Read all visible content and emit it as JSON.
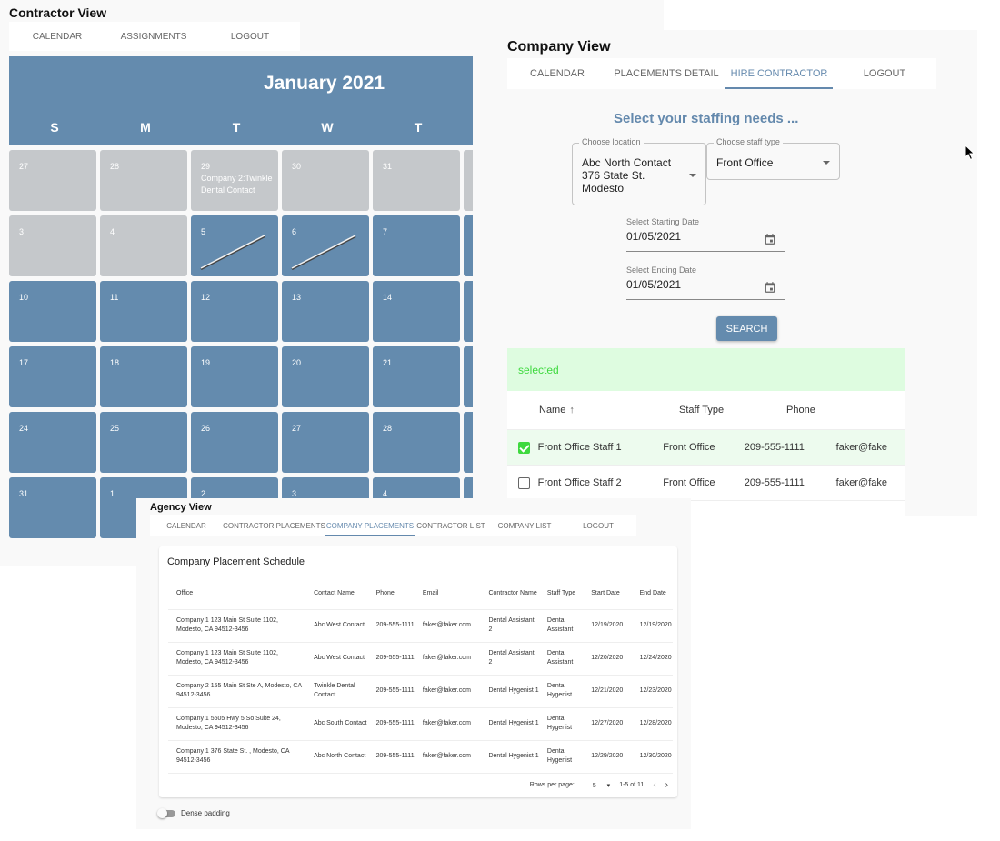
{
  "contractor": {
    "title": "Contractor View",
    "tabs": [
      {
        "label": "CALENDAR",
        "active": false
      },
      {
        "label": "ASSIGNMENTS",
        "active": false
      },
      {
        "label": "LOGOUT",
        "active": false
      }
    ],
    "calendar": {
      "month_label": "January 2021",
      "weekdays": [
        "S",
        "M",
        "T",
        "W",
        "T"
      ],
      "weeks": [
        [
          {
            "day": "27",
            "grey": true
          },
          {
            "day": "28",
            "grey": true
          },
          {
            "day": "29",
            "grey": true,
            "event": "Company 2:Twinkle Dental Contact"
          },
          {
            "day": "30",
            "grey": true
          },
          {
            "day": "31",
            "grey": true
          }
        ],
        [
          {
            "day": "3",
            "grey": true
          },
          {
            "day": "4",
            "grey": true
          },
          {
            "day": "5",
            "grey": false,
            "slashed": true
          },
          {
            "day": "6",
            "grey": false,
            "slashed": true
          },
          {
            "day": "7",
            "grey": false
          }
        ],
        [
          {
            "day": "10"
          },
          {
            "day": "11"
          },
          {
            "day": "12"
          },
          {
            "day": "13"
          },
          {
            "day": "14"
          }
        ],
        [
          {
            "day": "17"
          },
          {
            "day": "18"
          },
          {
            "day": "19"
          },
          {
            "day": "20"
          },
          {
            "day": "21"
          }
        ],
        [
          {
            "day": "24"
          },
          {
            "day": "25"
          },
          {
            "day": "26"
          },
          {
            "day": "27"
          },
          {
            "day": "28"
          }
        ],
        [
          {
            "day": "31"
          },
          {
            "day": "1"
          },
          {
            "day": "2"
          },
          {
            "day": "3"
          },
          {
            "day": "4"
          }
        ]
      ]
    }
  },
  "company": {
    "title": "Company View",
    "tabs": [
      {
        "label": "CALENDAR",
        "active": false
      },
      {
        "label": "PLACEMENTS DETAIL",
        "active": false
      },
      {
        "label": "HIRE CONTRACTOR",
        "active": true
      },
      {
        "label": "LOGOUT",
        "active": false
      }
    ],
    "heading": "Select your staffing needs ...",
    "location": {
      "label": "Choose location",
      "value_lines": [
        "Abc North Contact",
        "376 State St.",
        "Modesto"
      ]
    },
    "staff_type": {
      "label": "Choose staff type",
      "value": "Front Office"
    },
    "start_date": {
      "label": "Select Starting Date",
      "value": "01/05/2021"
    },
    "end_date": {
      "label": "Select Ending Date",
      "value": "01/05/2021"
    },
    "search_label": "SEARCH",
    "selected_text": "selected",
    "table": {
      "headers": {
        "name": "Name",
        "staff_type": "Staff Type",
        "phone": "Phone"
      },
      "rows": [
        {
          "checked": true,
          "name": "Front Office Staff 1",
          "staff_type": "Front Office",
          "phone": "209-555-1111",
          "email": "faker@fake"
        },
        {
          "checked": false,
          "name": "Front Office Staff 2",
          "staff_type": "Front Office",
          "phone": "209-555-1111",
          "email": "faker@fake"
        }
      ]
    }
  },
  "agency": {
    "title": "Agency View",
    "tabs": [
      {
        "label": "CALENDAR",
        "active": false
      },
      {
        "label": "CONTRACTOR PLACEMENTS",
        "active": false
      },
      {
        "label": "COMPANY PLACEMENTS",
        "active": true
      },
      {
        "label": "CONTRACTOR LIST",
        "active": false
      },
      {
        "label": "COMPANY LIST",
        "active": false
      },
      {
        "label": "LOGOUT",
        "active": false
      }
    ],
    "card_title": "Company Placement Schedule",
    "columns": [
      "Office",
      "Contact Name",
      "Phone",
      "Email",
      "Contractor Name",
      "Staff Type",
      "Start Date",
      "End Date"
    ],
    "rows": [
      [
        "Company 1 123 Main St Suite 1102, Modesto, CA 94512-3456",
        "Abc West Contact",
        "209-555-1111",
        "faker@faker.com",
        "Dental Assistant 2",
        "Dental Assistant",
        "12/19/2020",
        "12/19/2020"
      ],
      [
        "Company 1 123 Main St Suite 1102, Modesto, CA 94512-3456",
        "Abc West Contact",
        "209-555-1111",
        "faker@faker.com",
        "Dental Assistant 2",
        "Dental Assistant",
        "12/20/2020",
        "12/24/2020"
      ],
      [
        "Company 2 155 Main St Ste A, Modesto, CA 94512-3456",
        "Twinkle Dental Contact",
        "209-555-1111",
        "faker@faker.com",
        "Dental Hygenist 1",
        "Dental Hygenist",
        "12/21/2020",
        "12/23/2020"
      ],
      [
        "Company 1 5505 Hwy 5 So Suite 24, Modesto, CA 94512-3456",
        "Abc South Contact",
        "209-555-1111",
        "faker@faker.com",
        "Dental Hygenist 1",
        "Dental Hygenist",
        "12/27/2020",
        "12/28/2020"
      ],
      [
        "Company 1 376 State St. , Modesto, CA 94512-3456",
        "Abc North Contact",
        "209-555-1111",
        "faker@faker.com",
        "Dental Hygenist 1",
        "Dental Hygenist",
        "12/29/2020",
        "12/30/2020"
      ]
    ],
    "pagination": {
      "rows_per_page_label": "Rows per page:",
      "rows_per_page": "5",
      "range": "1-5 of 11"
    },
    "dense_label": "Dense padding",
    "dense_on": false
  },
  "colors": {
    "accent": "#648bae",
    "selected_green": "#3ed93e",
    "selected_bg": "#defce0",
    "grey_cell": "#c5c8cb"
  }
}
